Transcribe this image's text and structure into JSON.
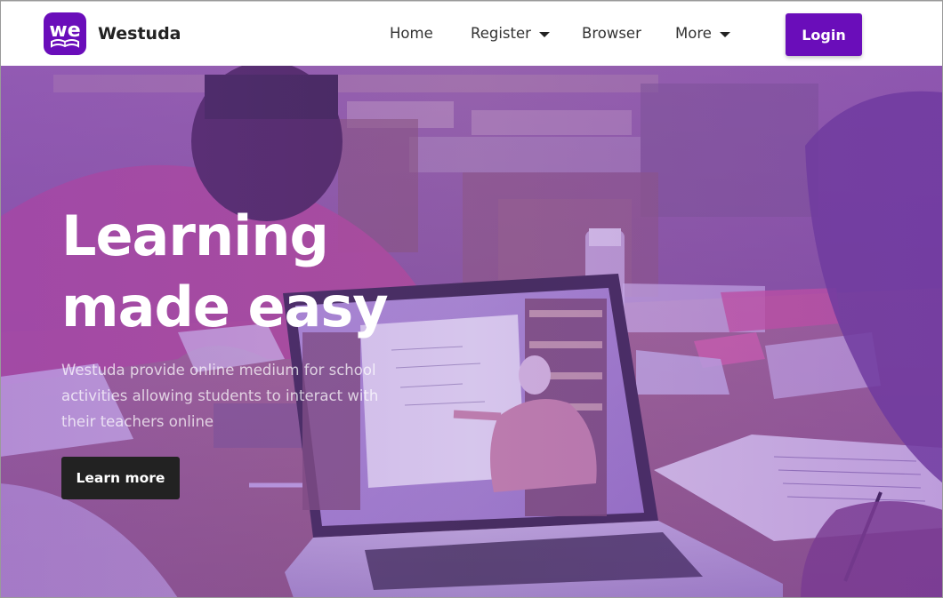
{
  "brand": {
    "logo_text": "we",
    "name": "Westuda",
    "color": "#6a0dba"
  },
  "nav": {
    "items": [
      {
        "label": "Home",
        "has_dropdown": false
      },
      {
        "label": "Register",
        "has_dropdown": true
      },
      {
        "label": "Browser",
        "has_dropdown": false
      },
      {
        "label": "More",
        "has_dropdown": true
      }
    ],
    "login_label": "Login"
  },
  "hero": {
    "title_line1": "Learning",
    "title_line2": "made easy",
    "description": "Westuda provide online medium for school activities allowing students to interact with their teachers online",
    "cta_label": "Learn more",
    "overlay_color": "#7b3fc4"
  },
  "icons": {
    "dropdown": "caret-down-icon",
    "logo": "book-logo-icon"
  }
}
